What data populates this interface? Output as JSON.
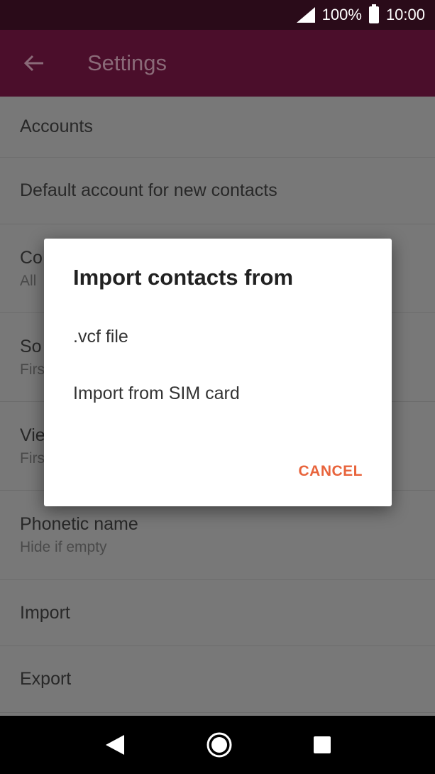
{
  "status": {
    "battery": "100%",
    "time": "10:00"
  },
  "app_bar": {
    "title": "Settings"
  },
  "list": {
    "items": [
      {
        "label": "Accounts",
        "sub": ""
      },
      {
        "label": "Default account for new contacts",
        "sub": ""
      },
      {
        "label": "Co",
        "sub": "All"
      },
      {
        "label": "So",
        "sub": "Firs"
      },
      {
        "label": "Vie",
        "sub": "Firs"
      },
      {
        "label": "Phonetic name",
        "sub": "Hide if empty"
      },
      {
        "label": "Import",
        "sub": ""
      },
      {
        "label": "Export",
        "sub": ""
      }
    ]
  },
  "dialog": {
    "title": "Import contacts from",
    "options": [
      ".vcf file",
      "Import from SIM card"
    ],
    "cancel": "CANCEL"
  },
  "colors": {
    "status_bar": "#2a0b19",
    "app_bar": "#4b0e2b",
    "accent": "#e8643c"
  },
  "icons": [
    "back-arrow-icon",
    "signal-icon",
    "battery-icon",
    "nav-back-icon",
    "nav-home-icon",
    "nav-recents-icon"
  ]
}
